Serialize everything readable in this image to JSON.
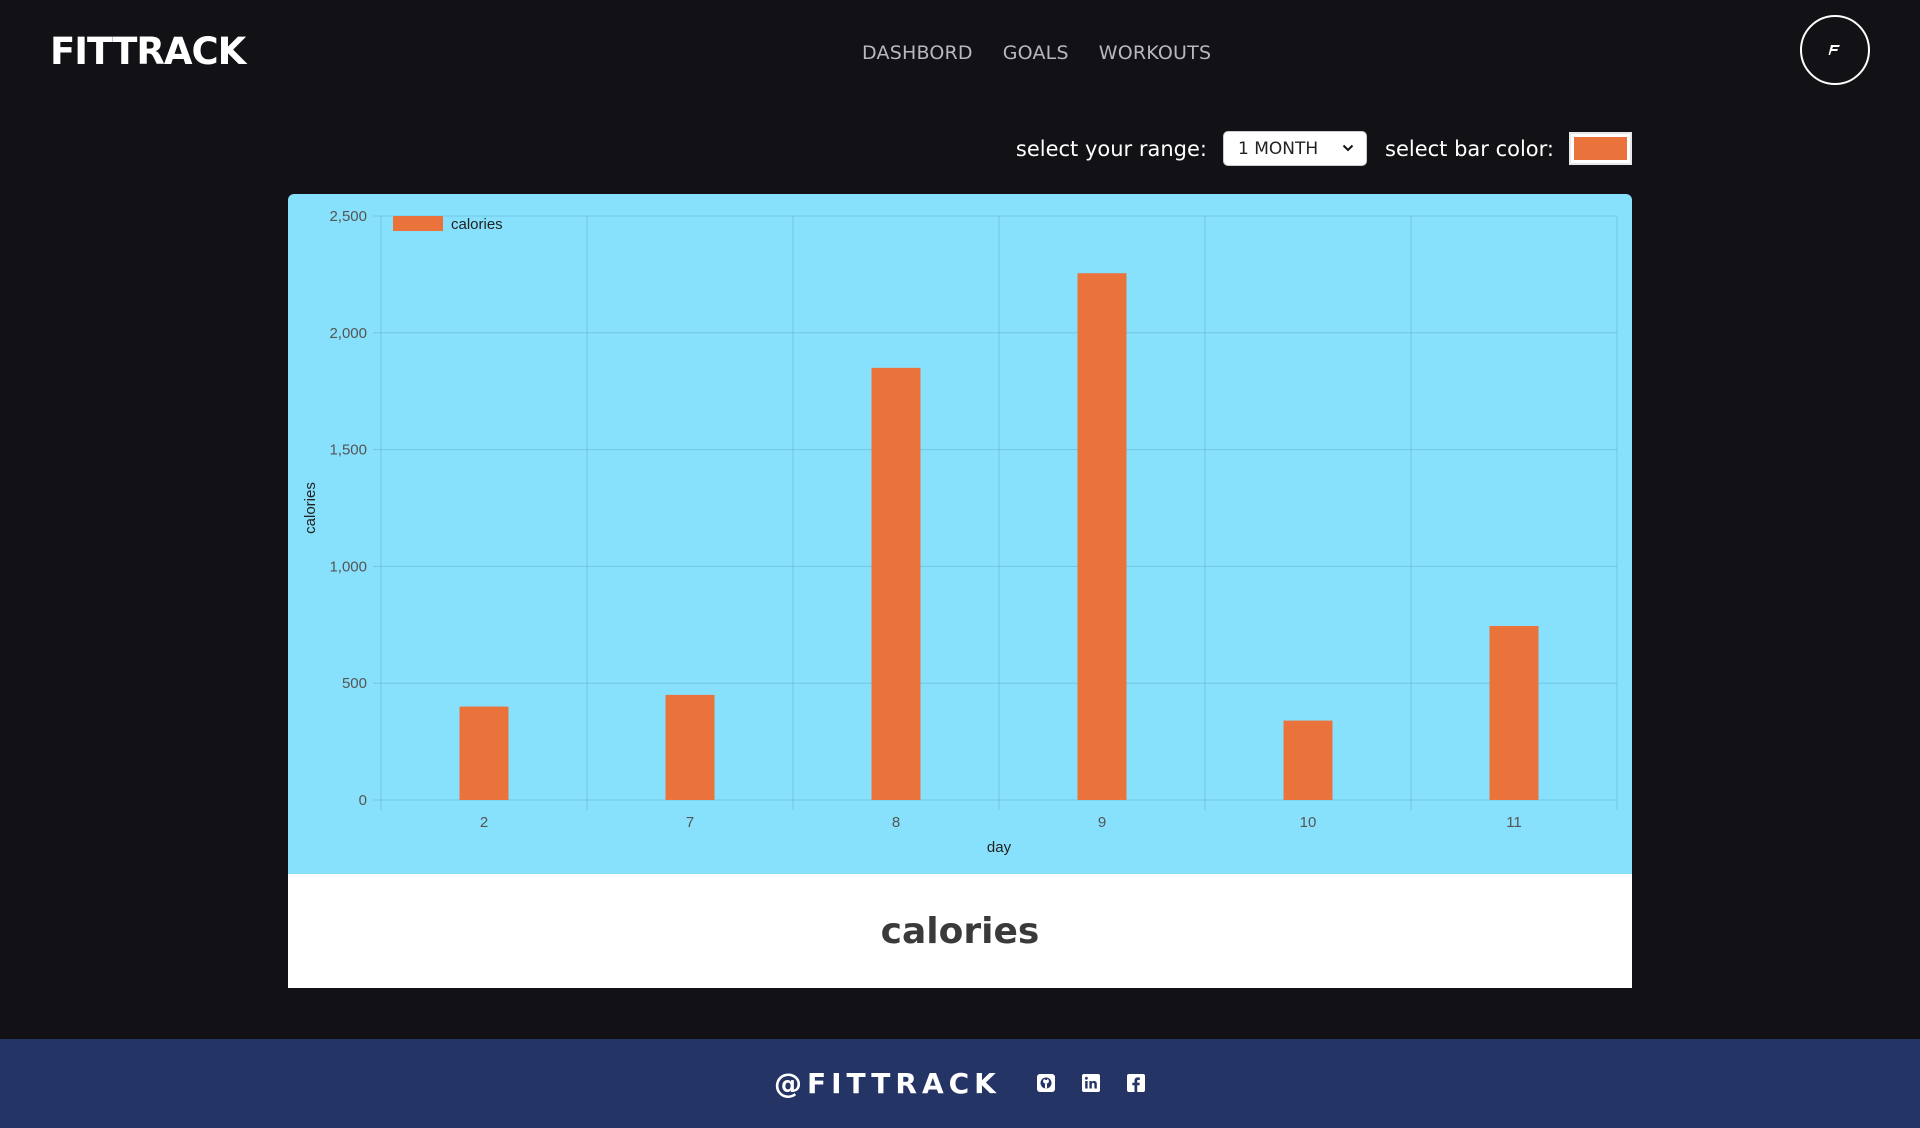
{
  "header": {
    "logo": "FITTRACK",
    "nav": [
      "DASHBORD",
      "GOALS",
      "WORKOUTS"
    ],
    "avatar_icon": "brand-f-icon"
  },
  "controls": {
    "range_label": "select your range:",
    "range_value": "1 MONTH",
    "color_label": "select bar color:",
    "bar_color": "#ea733b"
  },
  "chart_data": {
    "type": "bar",
    "categories": [
      "2",
      "7",
      "8",
      "9",
      "10",
      "11"
    ],
    "series": [
      {
        "name": "calories",
        "values": [
          400,
          450,
          1850,
          2255,
          340,
          745
        ]
      }
    ],
    "xlabel": "day",
    "ylabel": "calories",
    "ylim": [
      0,
      2500
    ],
    "yticks": [
      0,
      500,
      1000,
      1500,
      2000,
      2500
    ],
    "ytick_labels": [
      "0",
      "500",
      "1,000",
      "1,500",
      "2,000",
      "2,500"
    ],
    "grid": true,
    "legend": "top-left",
    "background": "#88e1fc"
  },
  "caption": {
    "title": "calories"
  },
  "footer": {
    "handle": "@FITTRACK",
    "social_icons": [
      "github-icon",
      "linkedin-icon",
      "facebook-icon"
    ],
    "background": "#243465"
  }
}
